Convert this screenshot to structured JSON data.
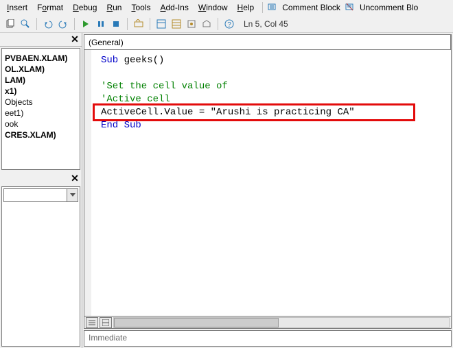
{
  "menu": {
    "items": [
      "Insert",
      "Format",
      "Debug",
      "Run",
      "Tools",
      "Add-Ins",
      "Window",
      "Help"
    ],
    "comment_block": "Comment Block",
    "uncomment_block": "Uncomment Blo"
  },
  "toolbar": {
    "status": "Ln 5, Col 45"
  },
  "project_tree": {
    "items": [
      "PVBAEN.XLAM)",
      "OL.XLAM)",
      "LAM)",
      "x1)",
      "Objects",
      "eet1)",
      "ook",
      "",
      "CRES.XLAM)"
    ]
  },
  "code_combo": {
    "left": "(General)"
  },
  "immediate_label": "Immediate",
  "code": {
    "lines": [
      {
        "segments": [
          {
            "t": "Sub ",
            "c": "kw"
          },
          {
            "t": "geeks()",
            "c": "ident"
          }
        ]
      },
      {
        "segments": [
          {
            "t": "",
            "c": "ident"
          }
        ]
      },
      {
        "segments": [
          {
            "t": "'Set the cell value of",
            "c": "cm"
          }
        ]
      },
      {
        "segments": [
          {
            "t": "'Active cell",
            "c": "cm"
          }
        ]
      },
      {
        "segments": [
          {
            "t": "ActiveCell.Value = ",
            "c": "ident"
          },
          {
            "t": "\"Arushi is practicing CA\"",
            "c": "str"
          }
        ]
      },
      {
        "segments": [
          {
            "t": "End Sub",
            "c": "kw"
          }
        ]
      }
    ],
    "highlight_line_index": 4
  }
}
